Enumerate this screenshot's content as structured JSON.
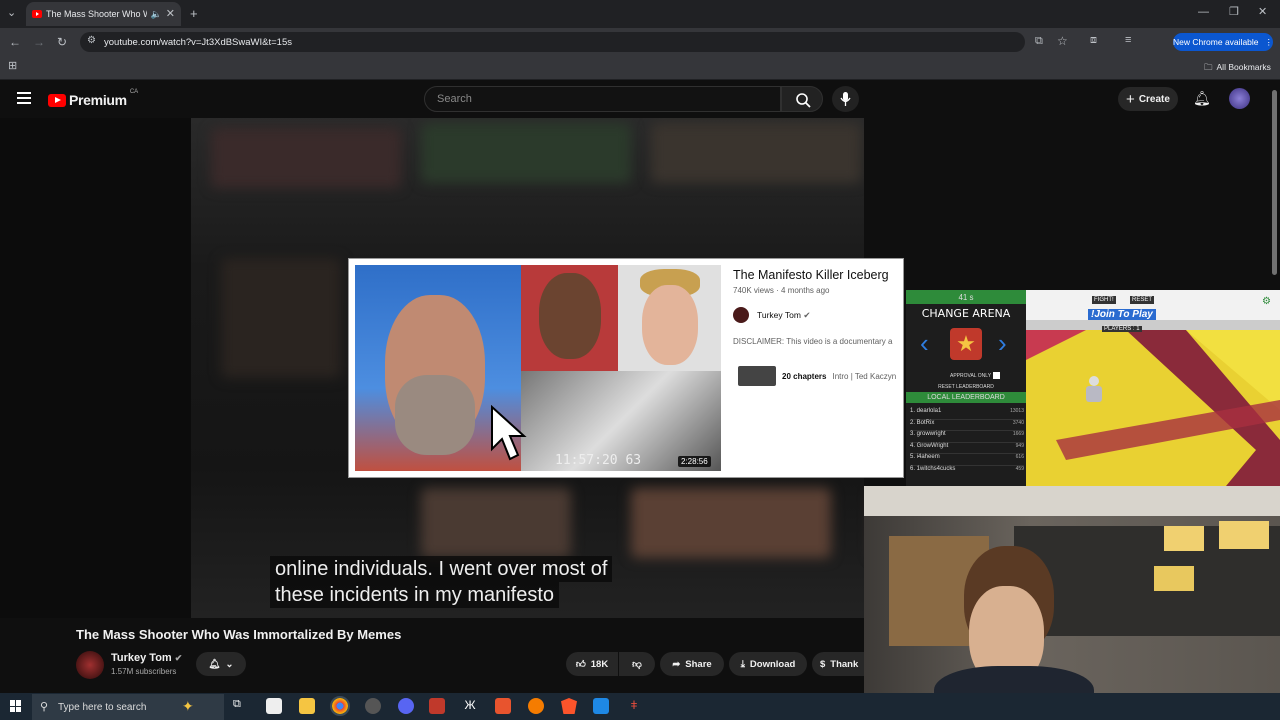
{
  "browser": {
    "tab_title": "The Mass Shooter Who Wa",
    "url": "youtube.com/watch?v=Jt3XdBSwaWI&t=15s",
    "new_chrome": "New Chrome available",
    "all_bookmarks": "All Bookmarks"
  },
  "youtube": {
    "logo": "Premium",
    "region": "CA",
    "search_placeholder": "Search",
    "create": "Create"
  },
  "caption": {
    "line1": "online individuals. I went over most of",
    "line2": "these incidents in my manifesto"
  },
  "card": {
    "title": "The Manifesto Killer Iceberg",
    "meta": "740K views · 4 months ago",
    "channel": "Turkey Tom",
    "disclaimer": "DISCLAIMER: This video is a documentary a",
    "chapters": "20 chapters",
    "chapters_detail": "Intro | Ted Kaczyn",
    "duration": "2:28:56",
    "timestamp": "11:57:20 63"
  },
  "arena": {
    "timer": "41 s",
    "title": "CHANGE ARENA",
    "approval": "APPROVAL ONLY",
    "reset": "RESET LEADERBOARD",
    "local": "LOCAL LEADERBOARD",
    "leaders": [
      {
        "name": "1. dearlola1",
        "score": "13013"
      },
      {
        "name": "2. BotRix",
        "score": "3740"
      },
      {
        "name": "3. growwright",
        "score": "1669"
      },
      {
        "name": "4. GrowWright",
        "score": "949"
      },
      {
        "name": "5. i4aheem",
        "score": "616"
      },
      {
        "name": "6. 1witchs4cucks",
        "score": "459"
      }
    ]
  },
  "game": {
    "fight": "FIGHT!",
    "reset": "RESET",
    "join": "!Join To Play",
    "players": "PLAYERS : 1"
  },
  "video": {
    "title": "The Mass Shooter Who Was Immortalized By Memes",
    "channel": "Turkey Tom",
    "subscribers": "1.57M subscribers",
    "likes": "18K",
    "share": "Share",
    "download": "Download",
    "thanks": "Thank"
  },
  "taskbar": {
    "search": "Type here to search"
  },
  "colors": {
    "yt_red": "#ff0000",
    "chrome_blue": "#0b57d0",
    "arena_green": "#2e8b3a"
  }
}
